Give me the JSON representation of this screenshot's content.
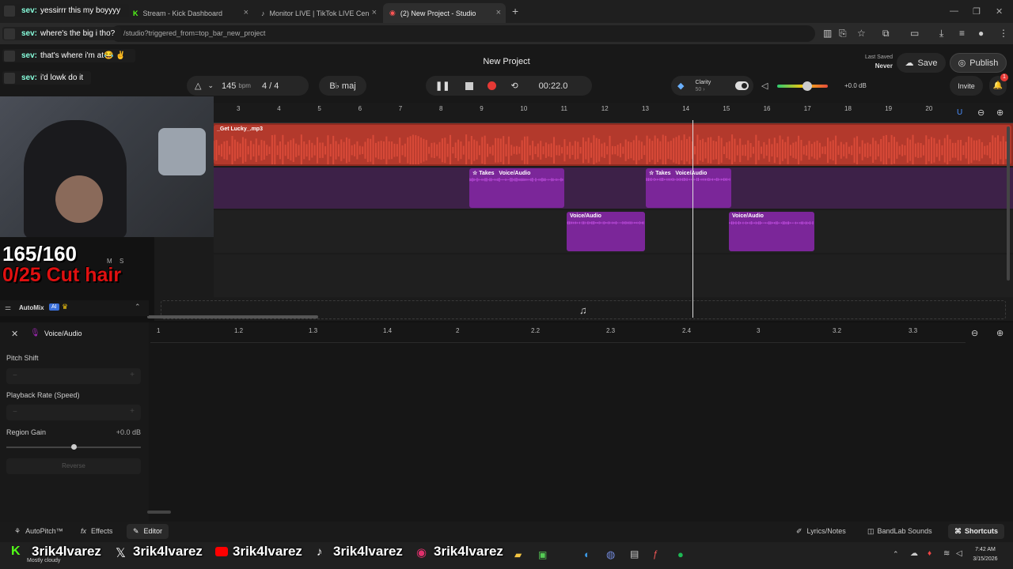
{
  "browser": {
    "tabs": [
      {
        "label": "sev: yessirrr this my boyyyy"
      },
      {
        "label": "Stream - Kick Dashboard"
      },
      {
        "label": "Monitor LIVE | TikTok LIVE Cen"
      },
      {
        "label": "(2) New Project - Studio"
      }
    ],
    "url": "/studio?triggered_from=top_bar_new_project"
  },
  "studio": {
    "project_title": "New Project",
    "last_saved_label": "Last Saved",
    "last_saved_value": "Never",
    "save_label": "Save",
    "publish_label": "Publish",
    "invite_label": "Invite",
    "notification_count": "1",
    "tempo": "145",
    "tempo_unit": "bpm",
    "time_signature": "4 / 4",
    "key": "B♭ maj",
    "timecode": "00:22.0",
    "clarity_label": "Clarity",
    "clarity_value": "50 ›",
    "master_gain": "+0.0 dB",
    "volume_level": 0.6
  },
  "ruler_numbers": [
    "3",
    "4",
    "5",
    "6",
    "7",
    "8",
    "9",
    "10",
    "11",
    "12",
    "13",
    "14",
    "15",
    "16",
    "17",
    "18",
    "19",
    "20"
  ],
  "tracks": {
    "track1_region_label": "_Get Lucky_.mp3",
    "takes_label": "Takes",
    "voice_label": "Voice/Audio"
  },
  "mixer": {
    "automix_label": "AutoMix",
    "ai_badge": "AI",
    "mute": "M",
    "solo": "S"
  },
  "editor": {
    "track_name": "Voice/Audio",
    "ruler": [
      "1",
      "1.2",
      "1.3",
      "1.4",
      "2",
      "2.2",
      "2.3",
      "2.4",
      "3",
      "3.2",
      "3.3"
    ],
    "pitch_shift_label": "Pitch Shift",
    "playback_rate_label": "Playback Rate (Speed)",
    "region_gain_label": "Region Gain",
    "region_gain_value": "+0.0 dB",
    "reverse_label": "Reverse"
  },
  "bottom_bar": {
    "autopitch": "AutoPitch™",
    "effects": "Effects",
    "editor": "Editor",
    "lyrics": "Lyrics/Notes",
    "sounds": "BandLab Sounds",
    "shortcuts": "Shortcuts"
  },
  "overlay": {
    "chat": [
      {
        "user": "sev:",
        "msg": "yessirrr this my boyyyy"
      },
      {
        "user": "sev:",
        "msg": "where's the big i tho?"
      },
      {
        "user": "sev:",
        "msg": "that's where i'm at😂 ✌"
      },
      {
        "user": "sev:",
        "msg": "i'd lowk do it"
      }
    ],
    "goal_counter": "165/160",
    "goal_text": "0/25 Cut hair",
    "socials": [
      "3rik4lvarez",
      "3rik4lvarez",
      "3rik4lvarez",
      "3rik4lvarez",
      "3rik4lvarez"
    ]
  },
  "taskbar": {
    "weather": "Mostly cloudy",
    "time": "7:42 AM",
    "date": "3/15/2026"
  },
  "colors": {
    "track_red": "#c0392b",
    "track_purple": "#7a2a9e",
    "region_purple": "#8e24aa",
    "accent_blue": "#3a6fd8"
  }
}
